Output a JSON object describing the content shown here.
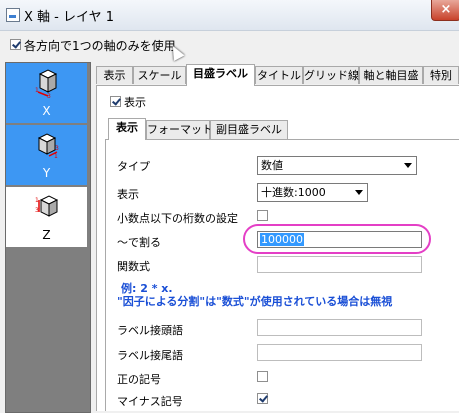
{
  "window": {
    "title": "X 軸 - レイヤ 1",
    "close_label": "×"
  },
  "top_option": {
    "label": "各方向で1つの軸のみを使用",
    "checked": true
  },
  "axes": [
    {
      "label": "X",
      "selected": true
    },
    {
      "label": "Y",
      "selected": true
    },
    {
      "label": "Z",
      "selected": false
    }
  ],
  "tabs": [
    "表示",
    "スケール",
    "目盛ラベル",
    "タイトル",
    "グリッド線",
    "軸と軸目盛",
    "特別"
  ],
  "active_tab": "目盛ラベル",
  "show": {
    "label": "表示",
    "checked": true
  },
  "subtabs": [
    "表示",
    "フォーマット",
    "副目盛ラベル"
  ],
  "active_subtab": "表示",
  "form": {
    "type_label": "タイプ",
    "type_value": "数値",
    "display_label": "表示",
    "display_value": "十進数:1000",
    "decimals_label": "小数点以下の桁数の設定",
    "decimals_checked": false,
    "divide_label": "〜で割る",
    "divide_value": "100000",
    "formula_label": "関数式",
    "formula_value": "",
    "note_line1": "例: 2 * x.",
    "note_line2": "\"因子による分割\"は\"数式\"が使用されている場合は無視",
    "prefix_label": "ラベル接頭語",
    "prefix_value": "",
    "suffix_label": "ラベル接尾語",
    "suffix_value": "",
    "plus_sign_label": "正の記号",
    "plus_sign_checked": false,
    "minus_sign_label": "マイナス記号",
    "minus_sign_checked": true
  },
  "colors": {
    "selected_axis": "#3d97f3",
    "highlight": "#e43fc6",
    "note_text": "#1a4fd6"
  }
}
